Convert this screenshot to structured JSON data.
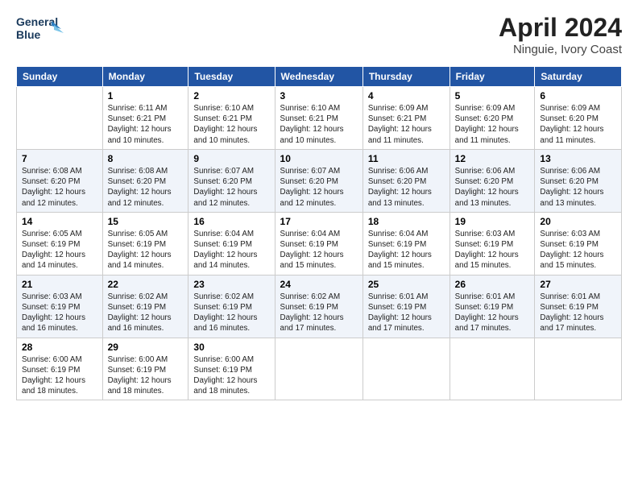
{
  "header": {
    "logo_line1": "General",
    "logo_line2": "Blue",
    "title": "April 2024",
    "subtitle": "Ninguie, Ivory Coast"
  },
  "weekdays": [
    "Sunday",
    "Monday",
    "Tuesday",
    "Wednesday",
    "Thursday",
    "Friday",
    "Saturday"
  ],
  "weeks": [
    [
      {
        "day": null
      },
      {
        "day": 1,
        "sunrise": "6:11 AM",
        "sunset": "6:21 PM",
        "daylight": "12 hours and 10 minutes."
      },
      {
        "day": 2,
        "sunrise": "6:10 AM",
        "sunset": "6:21 PM",
        "daylight": "12 hours and 10 minutes."
      },
      {
        "day": 3,
        "sunrise": "6:10 AM",
        "sunset": "6:21 PM",
        "daylight": "12 hours and 10 minutes."
      },
      {
        "day": 4,
        "sunrise": "6:09 AM",
        "sunset": "6:21 PM",
        "daylight": "12 hours and 11 minutes."
      },
      {
        "day": 5,
        "sunrise": "6:09 AM",
        "sunset": "6:20 PM",
        "daylight": "12 hours and 11 minutes."
      },
      {
        "day": 6,
        "sunrise": "6:09 AM",
        "sunset": "6:20 PM",
        "daylight": "12 hours and 11 minutes."
      }
    ],
    [
      {
        "day": 7,
        "sunrise": "6:08 AM",
        "sunset": "6:20 PM",
        "daylight": "12 hours and 12 minutes."
      },
      {
        "day": 8,
        "sunrise": "6:08 AM",
        "sunset": "6:20 PM",
        "daylight": "12 hours and 12 minutes."
      },
      {
        "day": 9,
        "sunrise": "6:07 AM",
        "sunset": "6:20 PM",
        "daylight": "12 hours and 12 minutes."
      },
      {
        "day": 10,
        "sunrise": "6:07 AM",
        "sunset": "6:20 PM",
        "daylight": "12 hours and 12 minutes."
      },
      {
        "day": 11,
        "sunrise": "6:06 AM",
        "sunset": "6:20 PM",
        "daylight": "12 hours and 13 minutes."
      },
      {
        "day": 12,
        "sunrise": "6:06 AM",
        "sunset": "6:20 PM",
        "daylight": "12 hours and 13 minutes."
      },
      {
        "day": 13,
        "sunrise": "6:06 AM",
        "sunset": "6:20 PM",
        "daylight": "12 hours and 13 minutes."
      }
    ],
    [
      {
        "day": 14,
        "sunrise": "6:05 AM",
        "sunset": "6:19 PM",
        "daylight": "12 hours and 14 minutes."
      },
      {
        "day": 15,
        "sunrise": "6:05 AM",
        "sunset": "6:19 PM",
        "daylight": "12 hours and 14 minutes."
      },
      {
        "day": 16,
        "sunrise": "6:04 AM",
        "sunset": "6:19 PM",
        "daylight": "12 hours and 14 minutes."
      },
      {
        "day": 17,
        "sunrise": "6:04 AM",
        "sunset": "6:19 PM",
        "daylight": "12 hours and 15 minutes."
      },
      {
        "day": 18,
        "sunrise": "6:04 AM",
        "sunset": "6:19 PM",
        "daylight": "12 hours and 15 minutes."
      },
      {
        "day": 19,
        "sunrise": "6:03 AM",
        "sunset": "6:19 PM",
        "daylight": "12 hours and 15 minutes."
      },
      {
        "day": 20,
        "sunrise": "6:03 AM",
        "sunset": "6:19 PM",
        "daylight": "12 hours and 15 minutes."
      }
    ],
    [
      {
        "day": 21,
        "sunrise": "6:03 AM",
        "sunset": "6:19 PM",
        "daylight": "12 hours and 16 minutes."
      },
      {
        "day": 22,
        "sunrise": "6:02 AM",
        "sunset": "6:19 PM",
        "daylight": "12 hours and 16 minutes."
      },
      {
        "day": 23,
        "sunrise": "6:02 AM",
        "sunset": "6:19 PM",
        "daylight": "12 hours and 16 minutes."
      },
      {
        "day": 24,
        "sunrise": "6:02 AM",
        "sunset": "6:19 PM",
        "daylight": "12 hours and 17 minutes."
      },
      {
        "day": 25,
        "sunrise": "6:01 AM",
        "sunset": "6:19 PM",
        "daylight": "12 hours and 17 minutes."
      },
      {
        "day": 26,
        "sunrise": "6:01 AM",
        "sunset": "6:19 PM",
        "daylight": "12 hours and 17 minutes."
      },
      {
        "day": 27,
        "sunrise": "6:01 AM",
        "sunset": "6:19 PM",
        "daylight": "12 hours and 17 minutes."
      }
    ],
    [
      {
        "day": 28,
        "sunrise": "6:00 AM",
        "sunset": "6:19 PM",
        "daylight": "12 hours and 18 minutes."
      },
      {
        "day": 29,
        "sunrise": "6:00 AM",
        "sunset": "6:19 PM",
        "daylight": "12 hours and 18 minutes."
      },
      {
        "day": 30,
        "sunrise": "6:00 AM",
        "sunset": "6:19 PM",
        "daylight": "12 hours and 18 minutes."
      },
      {
        "day": null
      },
      {
        "day": null
      },
      {
        "day": null
      },
      {
        "day": null
      }
    ]
  ]
}
